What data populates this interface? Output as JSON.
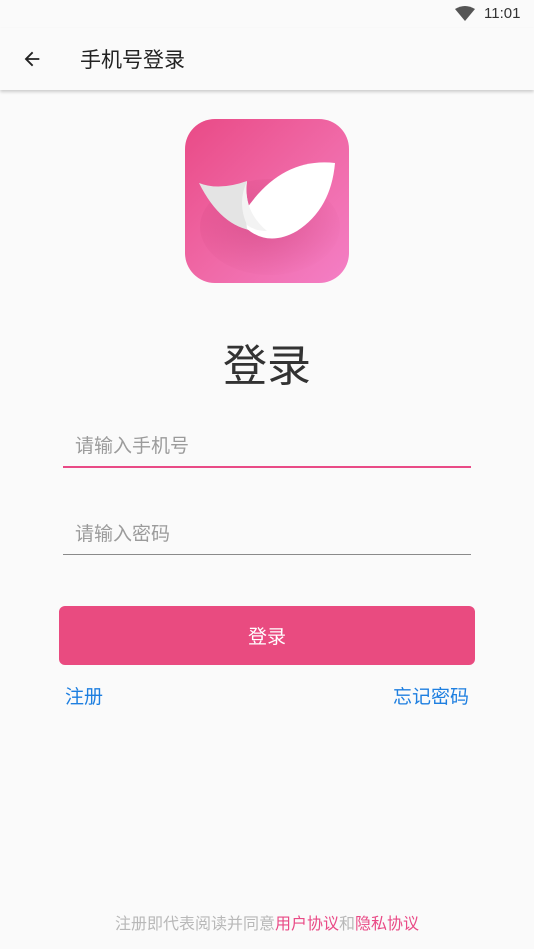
{
  "status_bar": {
    "time": "11:01",
    "wifi_icon": "wifi-icon"
  },
  "app_bar": {
    "back_icon": "arrow-left-icon",
    "title": "手机号登录"
  },
  "logo": {
    "icon": "app-logo-icon",
    "colors": {
      "start": "#e94a86",
      "end": "#f47fc6"
    }
  },
  "heading": "登录",
  "form": {
    "phone_placeholder": "请输入手机号",
    "phone_value": "",
    "password_placeholder": "请输入密码",
    "password_value": "",
    "login_button": "登录"
  },
  "links": {
    "register": "注册",
    "forgot_password": "忘记密码"
  },
  "agreement": {
    "prefix": "注册即代表阅读并同意",
    "user_agreement": "用户协议",
    "conjunction": "和",
    "privacy_policy": "隐私协议"
  },
  "colors": {
    "accent": "#e94a86",
    "link": "#1e7fe0",
    "background": "#fafafa"
  }
}
